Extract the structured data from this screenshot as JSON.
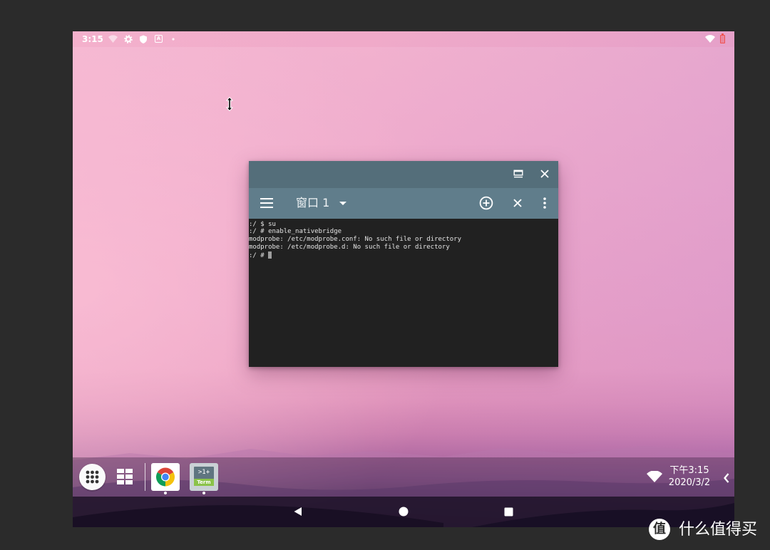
{
  "status_bar": {
    "time": "3:15",
    "left_icons": [
      "wifi-signal-icon",
      "gear-icon",
      "shield-icon",
      "a-box-icon",
      "dot-icon"
    ],
    "a_box_label": "A",
    "right_icons": [
      "wifi-icon",
      "battery-icon"
    ],
    "battery_color": "#ef5350"
  },
  "cursor": {
    "icon": "resize-vertical-cursor-icon"
  },
  "terminal_window": {
    "colors": {
      "title_bar": "#546e7a",
      "toolbar": "#607d8b",
      "body": "#212121"
    },
    "title_bar_icons": [
      "maximize-icon",
      "close-icon"
    ],
    "toolbar": {
      "menu_icon": "hamburger-menu-icon",
      "tab_label": "窗口 1",
      "tab_dropdown_icon": "caret-down-icon",
      "action_icons": [
        "add-circle-icon",
        "close-icon",
        "more-vert-icon"
      ]
    },
    "lines": [
      ":/ $ su",
      ":/ # enable_nativebridge",
      "modprobe: /etc/modprobe.conf: No such file or directory",
      "modprobe: /etc/modprobe.d: No such file or directory",
      ":/ # "
    ]
  },
  "taskbar": {
    "start_icon": "app-drawer-icon",
    "dashboard_icon": "grid-icon",
    "pinned_apps": [
      {
        "icon": "chrome-icon",
        "running": true
      },
      {
        "icon": "terminal-emulator-icon",
        "running": true,
        "icon_text_top": ">1+",
        "icon_text_bottom": "Term"
      }
    ],
    "tray": {
      "wifi_icon": "wifi-icon",
      "time": "下午3:15",
      "date": "2020/3/2",
      "expand_icon": "chevron-left-icon"
    }
  },
  "nav_bar": {
    "buttons": [
      "back-icon",
      "home-icon",
      "recents-icon"
    ]
  },
  "watermark": {
    "logo_char": "值",
    "text": "什么值得买"
  }
}
